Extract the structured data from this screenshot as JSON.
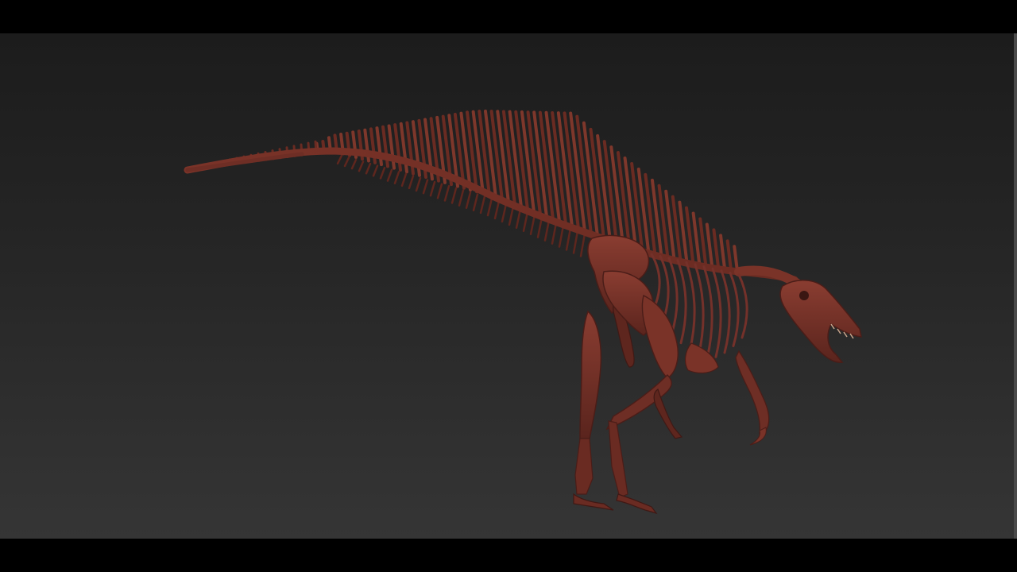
{
  "scene": {
    "subject_icon": "spinosaurus-skeleton-icon",
    "colors": {
      "background_top": "#1c1c1c",
      "background_bottom": "#353535",
      "letterbox": "#000000",
      "bone_base": "#6e2e25",
      "bone_light": "#8a3d31",
      "bone_dark": "#4a1d18"
    }
  }
}
